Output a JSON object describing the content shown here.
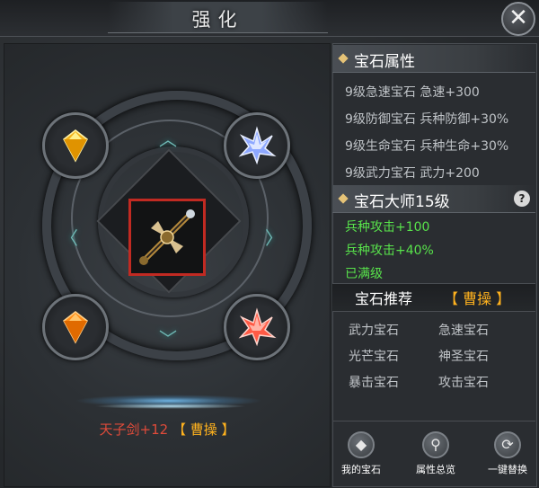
{
  "window": {
    "title": "强化"
  },
  "weapon": {
    "name": "天子剑+12",
    "hero": "【 曹操 】"
  },
  "sockets": [
    {
      "gem": "yellow-gem",
      "color": "#f2b21b"
    },
    {
      "gem": "blue-crystal",
      "color": "#8ea8ff"
    },
    {
      "gem": "orange-gem",
      "color": "#ff8c17"
    },
    {
      "gem": "red-crystal",
      "color": "#ff5a45"
    }
  ],
  "gem_attributes": {
    "header": "宝石属性",
    "rows": [
      "9级急速宝石 急速+300",
      "9级防御宝石 兵种防御+30%",
      "9级生命宝石 兵种生命+30%",
      "9级武力宝石 武力+200"
    ]
  },
  "gem_master": {
    "header": "宝石大师15级",
    "help": "?",
    "rows": [
      "兵种攻击+100",
      "兵种攻击+40%",
      "已满级"
    ]
  },
  "recommend": {
    "title": "宝石推荐",
    "hero": "【 曹操 】",
    "items": [
      "武力宝石",
      "急速宝石",
      "光芒宝石",
      "神圣宝石",
      "暴击宝石",
      "攻击宝石"
    ]
  },
  "bottom_buttons": [
    {
      "label": "我的宝石",
      "icon": "gem-icon"
    },
    {
      "label": "属性总览",
      "icon": "magnifier-icon"
    },
    {
      "label": "一键替换",
      "icon": "refresh-icon"
    }
  ],
  "colors": {
    "accent_gold": "#ffb21e",
    "green": "#58e34b",
    "weapon_red": "#e04b3a"
  }
}
